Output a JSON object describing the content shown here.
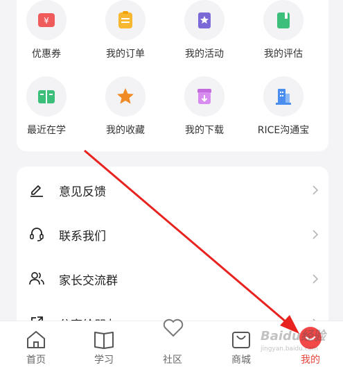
{
  "grid": {
    "items": [
      {
        "label": "优惠券",
        "icon": "coupon-icon"
      },
      {
        "label": "我的订单",
        "icon": "clipboard-icon"
      },
      {
        "label": "我的活动",
        "icon": "star-bookmark-icon"
      },
      {
        "label": "我的评估",
        "icon": "green-book-icon"
      },
      {
        "label": "最近在学",
        "icon": "open-book-icon"
      },
      {
        "label": "我的收藏",
        "icon": "star-icon"
      },
      {
        "label": "我的下载",
        "icon": "download-box-icon"
      },
      {
        "label": "RICE沟通宝",
        "icon": "building-icon"
      }
    ]
  },
  "menu": {
    "items": [
      {
        "label": "意见反馈",
        "icon": "pen-icon"
      },
      {
        "label": "联系我们",
        "icon": "headset-icon"
      },
      {
        "label": "家长交流群",
        "icon": "people-icon"
      },
      {
        "label": "分享给朋友",
        "icon": "share-icon"
      }
    ]
  },
  "tabbar": {
    "tabs": [
      {
        "label": "首页",
        "icon": "home-icon"
      },
      {
        "label": "学习",
        "icon": "book-icon"
      },
      {
        "label": "社区",
        "icon": "heart-icon"
      },
      {
        "label": "商城",
        "icon": "shopping-bag-icon"
      },
      {
        "label": "我的",
        "icon": "smile-icon",
        "active": true
      }
    ]
  },
  "watermark": {
    "text": "Baidu经验",
    "sub": "jingyan.baidu.com"
  },
  "colors": {
    "accent": "#f24848",
    "arrow": "#e8231f"
  }
}
